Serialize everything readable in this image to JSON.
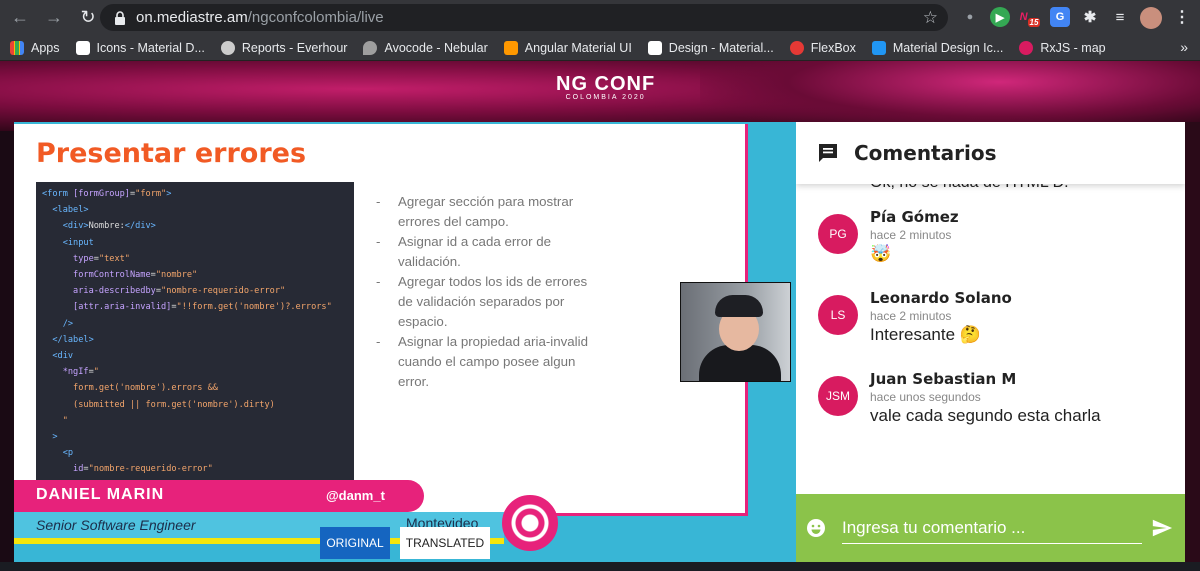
{
  "browser": {
    "url_host": "on.mediastre.am",
    "url_path": "/ngconfcolombia/live",
    "extension_badge": "15"
  },
  "bookmarks": [
    {
      "label": "Apps",
      "color": "#e8eaed"
    },
    {
      "label": "Icons - Material D...",
      "color": "#ffffff"
    },
    {
      "label": "Reports - Everhour",
      "color": "#cccccc"
    },
    {
      "label": "Avocode - Nebular",
      "color": "#9e9e9e"
    },
    {
      "label": "Angular Material UI",
      "color": "#ff9800"
    },
    {
      "label": "Design - Material...",
      "color": "#ffffff"
    },
    {
      "label": "FlexBox",
      "color": "#e53935"
    },
    {
      "label": "Material Design Ic...",
      "color": "#2196f3"
    },
    {
      "label": "RxJS - map",
      "color": "#d81b60"
    }
  ],
  "event": {
    "logo_title": "NG CONF",
    "logo_subtitle": "COLOMBIA 2020"
  },
  "slide": {
    "title": "Presentar errores",
    "bullets": [
      "Agregar sección para mostrar errores del campo.",
      "Asignar id a cada error de validación.",
      "Agregar todos los ids de errores de validación separados por espacio.",
      "Asignar la propiedad aria-invalid cuando el campo posee algun error."
    ]
  },
  "speaker": {
    "name": "DANIEL MARIN",
    "handle": "@danm_t",
    "role": "Senior Software Engineer",
    "location": "Montevideo"
  },
  "player_buttons": {
    "original": "ORIGINAL",
    "translated": "TRANSLATED"
  },
  "comments_panel": {
    "title": "Comentarios",
    "truncated_text": "Ok, no se nada de HTML D.",
    "comments": [
      {
        "initials": "PG",
        "author": "Pía Gómez",
        "time": "hace 2 minutos",
        "text": "🤯"
      },
      {
        "initials": "LS",
        "author": "Leonardo Solano",
        "time": "hace 2 minutos",
        "text": "Interesante 🤔"
      },
      {
        "initials": "JSM",
        "author": "Juan Sebastian M",
        "time": "hace unos segundos",
        "text": "vale cada segundo esta charla"
      }
    ],
    "input_placeholder": "Ingresa tu comentario ..."
  },
  "colors": {
    "accent_pink": "#e7227b",
    "slide_title": "#f15a24",
    "composer_green": "#8bc34a",
    "avatar": "#d81b60"
  }
}
